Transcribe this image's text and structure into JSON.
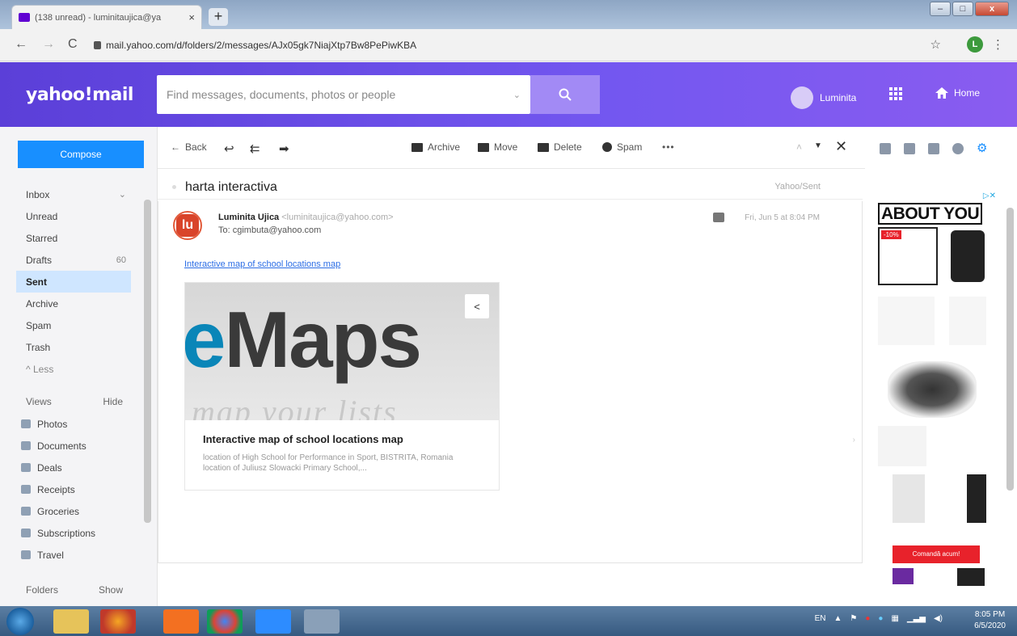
{
  "browser": {
    "tab_title": "(138 unread) - luminitaujica@ya",
    "url": "mail.yahoo.com/d/folders/2/messages/AJx05gk7NiajXtp7Bw8PePiwKBA",
    "profile_initial": "L"
  },
  "header": {
    "logo": "yahoo!mail",
    "search_placeholder": "Find messages, documents, photos or people",
    "user_name": "Luminita",
    "home_label": "Home"
  },
  "sidebar": {
    "compose_label": "Compose",
    "folders": [
      {
        "label": "Inbox",
        "count": ""
      },
      {
        "label": "Unread",
        "count": ""
      },
      {
        "label": "Starred",
        "count": ""
      },
      {
        "label": "Drafts",
        "count": "60"
      },
      {
        "label": "Sent",
        "count": ""
      },
      {
        "label": "Archive",
        "count": ""
      },
      {
        "label": "Spam",
        "count": ""
      },
      {
        "label": "Trash",
        "count": ""
      },
      {
        "label": "^ Less",
        "count": ""
      }
    ],
    "views_label": "Views",
    "views_toggle": "Hide",
    "views": [
      "Photos",
      "Documents",
      "Deals",
      "Receipts",
      "Groceries",
      "Subscriptions",
      "Travel"
    ],
    "folders_label": "Folders",
    "folders_toggle": "Show"
  },
  "toolbar": {
    "back": "Back",
    "archive": "Archive",
    "move": "Move",
    "delete": "Delete",
    "spam": "Spam",
    "more": "•••"
  },
  "message": {
    "subject": "harta interactiva",
    "folder": "Yahoo/Sent",
    "from_name": "Luminita Ujica",
    "from_email": "<luminitaujica@yahoo.com>",
    "to": "To: cgimbuta@yahoo.com",
    "date": "Fri, Jun 5 at 8:04 PM",
    "link_text": "Interactive map of school locations map",
    "card": {
      "image_text_main": "Maps",
      "image_text_prefix": "e",
      "image_text_sub": "map your lists",
      "title": "Interactive map of school locations map",
      "description": "location of High School for Performance in Sport, BISTRITA, Romania location of Juliusz Slowacki Primary School,..."
    }
  },
  "ad": {
    "brand": "ABOUT YOU",
    "badge": "-10%",
    "cta": "Comandă acum!"
  },
  "taskbar": {
    "lang": "EN",
    "time": "8:05 PM",
    "date": "6/5/2020"
  }
}
